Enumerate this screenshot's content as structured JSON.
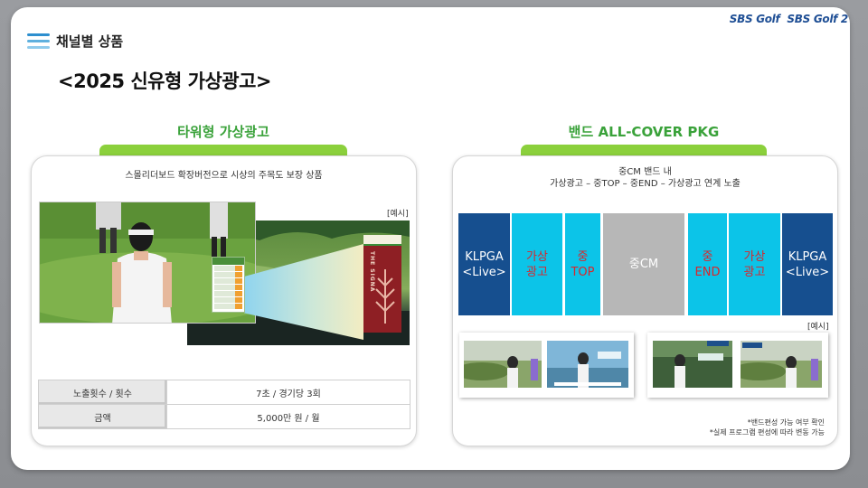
{
  "header": {
    "channel_title": "채널별 상품",
    "main_title": "<2025 신유형 가상광고>",
    "logos": [
      "SBS Golf",
      "SBS Golf 2"
    ]
  },
  "left": {
    "section_title": "타워형 가상광고",
    "description": "스몰리더보드 확장버전으로 시상의 주목도 보장 상품",
    "example_label": "[예시]",
    "brand_text": "THE SIGNA",
    "table": [
      {
        "label": "노출횟수 / 횟수",
        "value": "7초 / 경기당 3회"
      },
      {
        "label": "금액",
        "value": "5,000만 원 / 월"
      }
    ]
  },
  "right": {
    "section_title": "밴드 ALL-COVER PKG",
    "description_line1": "중CM 밴드 내",
    "description_line2": "가상광고 – 중TOP – 중END – 가상광고 연계 노출",
    "example_label": "[예시]",
    "blocks": [
      {
        "text": "KLPGA\n<Live>",
        "style": "navy"
      },
      {
        "text": "가상\n광고",
        "style": "cyan"
      },
      {
        "text": "중\nTOP",
        "style": "cyan"
      },
      {
        "text": "중CM",
        "style": "gray"
      },
      {
        "text": "중\nEND",
        "style": "cyan"
      },
      {
        "text": "가상\n광고",
        "style": "cyan"
      },
      {
        "text": "KLPGA\n<Live>",
        "style": "navy"
      }
    ],
    "footnote_line1": "*밴드편성 가능 여부 확인",
    "footnote_line2": "*실제 프로그램 편성에 따라 변동 가능"
  },
  "colors": {
    "navy": "#164f8f",
    "cyan": "#0cc4e8",
    "red_text": "#d9262b",
    "green_title": "#3aa23a",
    "green_bar": "#8bd03c"
  }
}
